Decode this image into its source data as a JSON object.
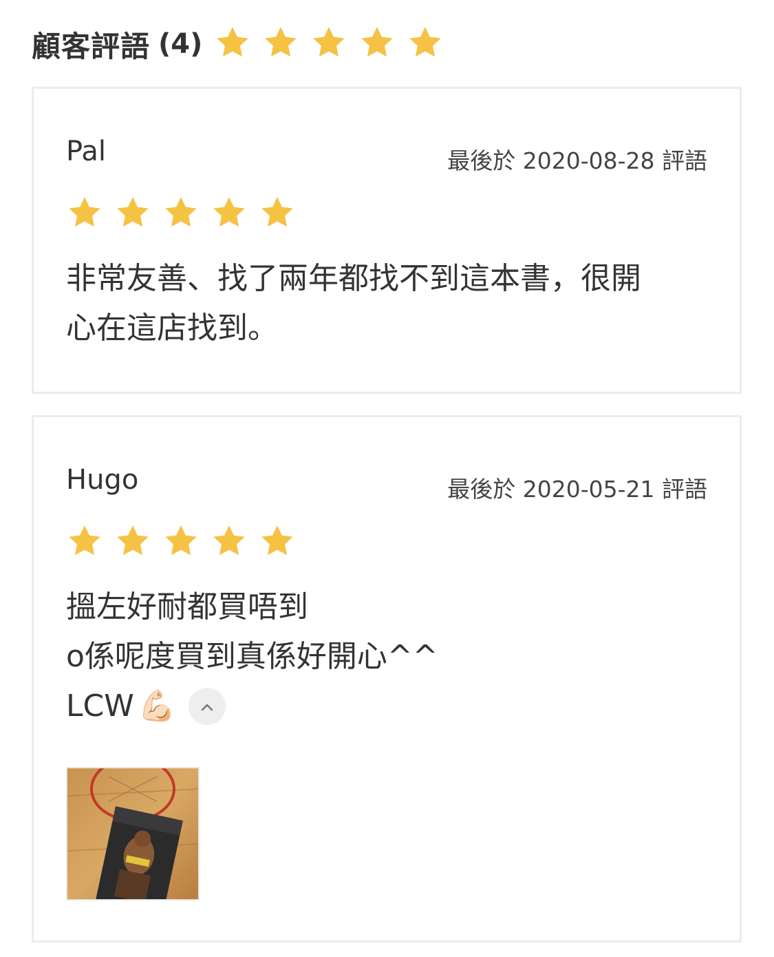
{
  "header": {
    "title": "顧客評語",
    "count": "(4)",
    "rating": 5
  },
  "colors": {
    "star": "#f6c244",
    "border": "#ececec",
    "text": "#333333"
  },
  "reviews": [
    {
      "reviewer": "Pal",
      "date": "最後於 2020-08-28 評語",
      "rating": 5,
      "lines": [
        "非常友善、找了兩年都找不到這本書，很開",
        "心在這店找到。"
      ]
    },
    {
      "reviewer": "Hugo",
      "date": "最後於 2020-05-21 評語",
      "rating": 5,
      "lines": [
        "搵左好耐都買唔到",
        "o係呢度買到真係好開心^^",
        "LCW"
      ],
      "emoji": "💪🏻",
      "photo_icon": "book-photo",
      "collapse_icon": "chevron-up-icon"
    }
  ]
}
